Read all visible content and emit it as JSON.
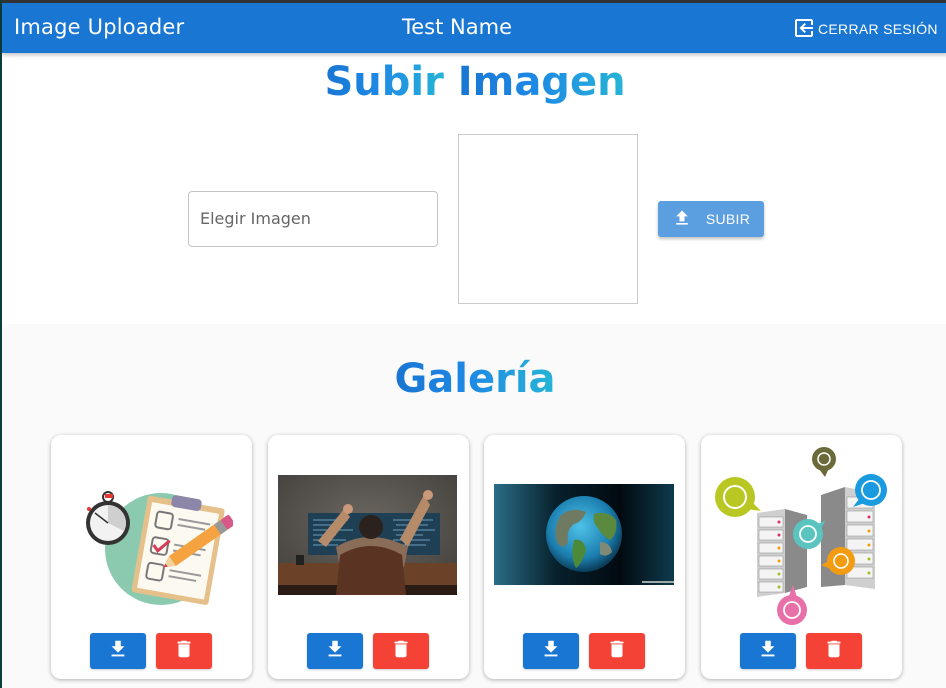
{
  "appbar": {
    "title": "Image Uploader",
    "user_name": "Test Name",
    "logout_label": "CERRAR SESIÓN",
    "logout_icon": "logout-icon",
    "color": "#1976d2"
  },
  "upload": {
    "title_part1": "Subir",
    "title_part2": "Imagen",
    "file_input_placeholder": "Elegir Imagen",
    "preview_label": "Image preview",
    "upload_button_label": "SUBIR",
    "upload_icon": "upload-icon",
    "upload_button_color": "#5b9fe0"
  },
  "gallery": {
    "title": "Galería",
    "cards": [
      {
        "image_description": "Clipboard checklist with stopwatch and pencil illustration",
        "download_icon": "download-icon",
        "delete_icon": "trash-icon"
      },
      {
        "image_description": "Programmer cheering in front of monitors with code",
        "download_icon": "download-icon",
        "delete_icon": "trash-icon"
      },
      {
        "image_description": "Digital globe of Earth on dark background",
        "download_icon": "download-icon",
        "delete_icon": "trash-icon"
      },
      {
        "image_description": "Server racks with colorful globe speech bubbles",
        "download_icon": "download-icon",
        "delete_icon": "trash-icon"
      }
    ],
    "download_color": "#1976d2",
    "delete_color": "#f44336"
  }
}
